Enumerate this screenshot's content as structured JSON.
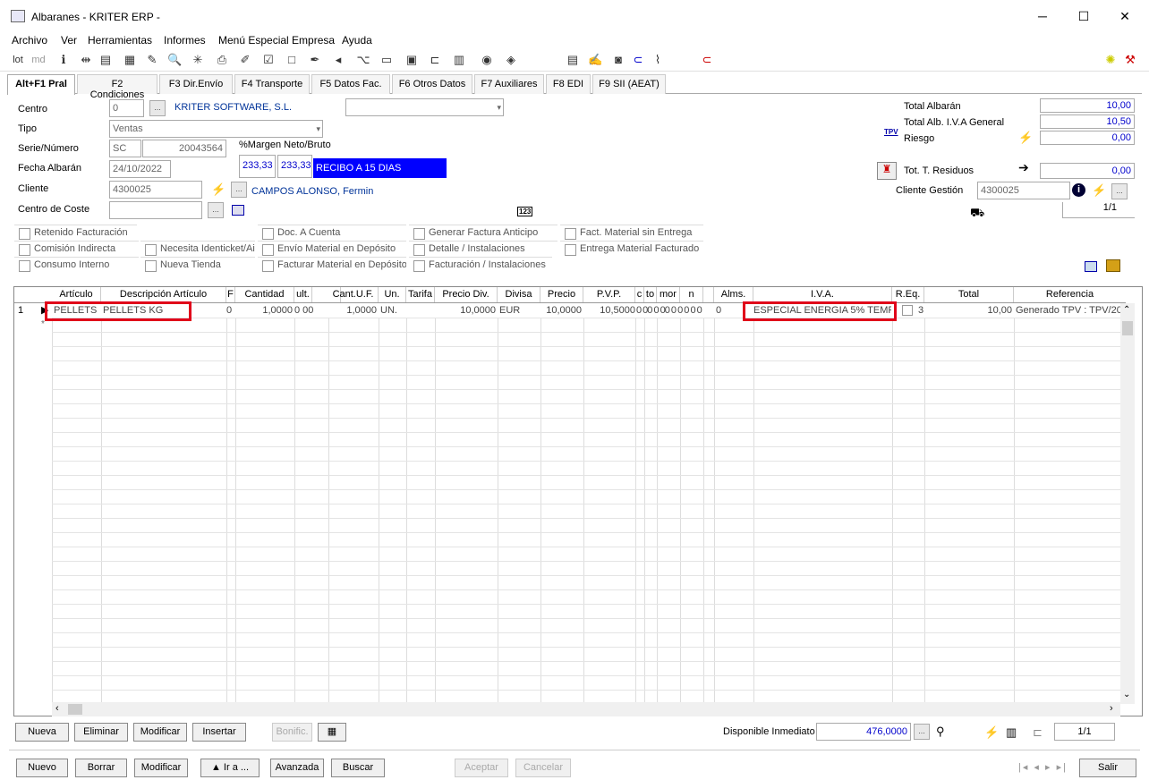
{
  "window": {
    "title": "Albaranes - KRITER ERP -",
    "minimize": "─",
    "maximize": "☐",
    "close": "✕"
  },
  "menu": [
    "Archivo",
    "Ver",
    "Herramientas",
    "Informes",
    "Menú Especial Empresa",
    "Ayuda"
  ],
  "toolbar": {
    "lot": "lot",
    "md": "md"
  },
  "tabs": [
    "Alt+F1 Pral",
    "F2 Condiciones",
    "F3 Dir.Envío",
    "F4 Transporte",
    "F5 Datos Fac.",
    "F6 Otros Datos",
    "F7 Auxiliares",
    "F8 EDI",
    "F9 SII (AEAT)"
  ],
  "form": {
    "centro_label": "Centro",
    "centro_value": "0",
    "centro_name": "KRITER SOFTWARE, S.L.",
    "tipo_label": "Tipo",
    "tipo_value": "Ventas",
    "serie_label": "Serie/Número",
    "serie_value": "SC",
    "numero_value": "20043564",
    "margen_label": "%Margen Neto/Bruto",
    "margen_neto": "233,33",
    "margen_bruto": "233,33",
    "forma_pago": "RECIBO A 15 DIAS",
    "fecha_label": "Fecha Albarán",
    "fecha_value": "24/10/2022",
    "cliente_label": "Cliente",
    "cliente_value": "4300025",
    "cliente_name": "CAMPOS ALONSO, Fermin",
    "cc_label": "Centro de Coste",
    "badge123": "123"
  },
  "totals": {
    "total_albaran_label": "Total Albarán",
    "total_albaran": "10,00",
    "total_iva_label": "Total Alb. I.V.A General",
    "total_iva": "10,50",
    "tpv": "TPV",
    "riesgo_label": "Riesgo",
    "riesgo": "0,00",
    "residuos_label": "Tot. T. Residuos",
    "residuos": "0,00",
    "cliente_gestion_label": "Cliente Gestión",
    "cliente_gestion": "4300025",
    "pager": "1/1"
  },
  "checks": [
    [
      "Retenido Facturación",
      "Doc. A Cuenta",
      "Generar Factura Anticipo",
      "Fact. Material sin Entrega"
    ],
    [
      "Comisión Indirecta",
      "Necesita Identicket/Ai",
      "Envío Material en Depósito",
      "Detalle / Instalaciones",
      "Entrega Material Facturado"
    ],
    [
      "Consumo Interno",
      "Nueva Tienda",
      "Facturar Material en Depósito",
      "Facturación / Instalaciones"
    ]
  ],
  "grid": {
    "headers": [
      "Artículo",
      "Descripción Artículo",
      "F",
      "Cantidad",
      "ult.",
      "Cant.U.F.",
      "Un.",
      "Tarifa",
      "Precio Div.",
      "Divisa",
      "Precio",
      "P.V.P.",
      "c",
      "to",
      "mor",
      "n",
      "Alms.",
      "I.V.A.",
      "R.Eq.",
      "Total",
      "Referencia"
    ],
    "row": {
      "n": "1",
      "articulo": "PELLETS",
      "descripcion": "PELLETS KG",
      "f": "0",
      "cantidad": "1,0000",
      "ult": "0 00",
      "cantuf": "1,0000",
      "un": "UN.",
      "precio_div": "10,0000",
      "divisa": "EUR",
      "precio": "10,0000",
      "pvp": "10,5000",
      "misc": "0 00 0 00 0 0 0 0 0",
      "alms": "0",
      "iva": "ESPECIAL ENERGIA 5% TEMP",
      "req": "3",
      "total": "10,00",
      "referencia": "Generado TPV : TPV/20"
    }
  },
  "grid_buttons": {
    "nueva": "Nueva",
    "eliminar": "Eliminar",
    "modificar": "Modificar",
    "insertar": "Insertar",
    "bonific": "Bonific.",
    "disponible_label": "Disponible Inmediato",
    "disponible": "476,0000",
    "pager": "1/1"
  },
  "bottom": {
    "nuevo": "Nuevo",
    "borrar": "Borrar",
    "modificar": "Modificar",
    "ira": "▲ Ir a ...",
    "avanzada": "Avanzada",
    "buscar": "Buscar",
    "aceptar": "Aceptar",
    "cancelar": "Cancelar",
    "salir": "Salir"
  }
}
